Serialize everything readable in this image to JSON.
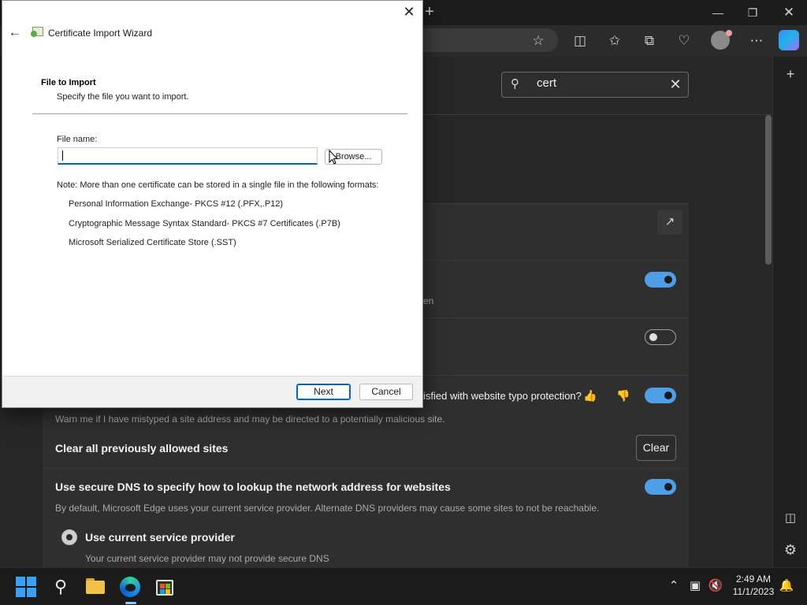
{
  "wizard": {
    "title": "Certificate Import Wizard",
    "heading": "File to Import",
    "subheading": "Specify the file you want to import.",
    "file_label": "File name:",
    "file_value": "",
    "browse_label": "Browse...",
    "note": "Note:  More than one certificate can be stored in a single file in the following formats:",
    "formats": [
      "Personal Information Exchange- PKCS #12 (.PFX,.P12)",
      "Cryptographic Message Syntax Standard- PKCS #7 Certificates (.P7B)",
      "Microsoft Serialized Certificate Store (.SST)"
    ],
    "next_label": "Next",
    "cancel_label": "Cancel"
  },
  "edge": {
    "search_value": "cert",
    "typo_row_title": "isfied with website typo protection?",
    "typo_row_desc": "Warn me if I have mistyped a site address and may be directed to a potentially malicious site.",
    "partial_desc": "en",
    "clear_sites_title": "Clear all previously allowed sites",
    "clear_button": "Clear",
    "dns_title": "Use secure DNS to specify how to lookup the network address for websites",
    "dns_desc": "By default, Microsoft Edge uses your current service provider. Alternate DNS providers may cause some sites to not be reachable.",
    "radio_title": "Use current service provider",
    "radio_desc": "Your current service provider may not provide secure DNS",
    "toggles": {
      "toggle_1": true,
      "toggle_2": false,
      "typo_protection": true,
      "secure_dns": true
    }
  },
  "taskbar": {
    "time": "2:49 AM",
    "date": "11/1/2023"
  },
  "colors": {
    "accent": "#0067c0",
    "toggle_on": "#4f9ee8"
  }
}
